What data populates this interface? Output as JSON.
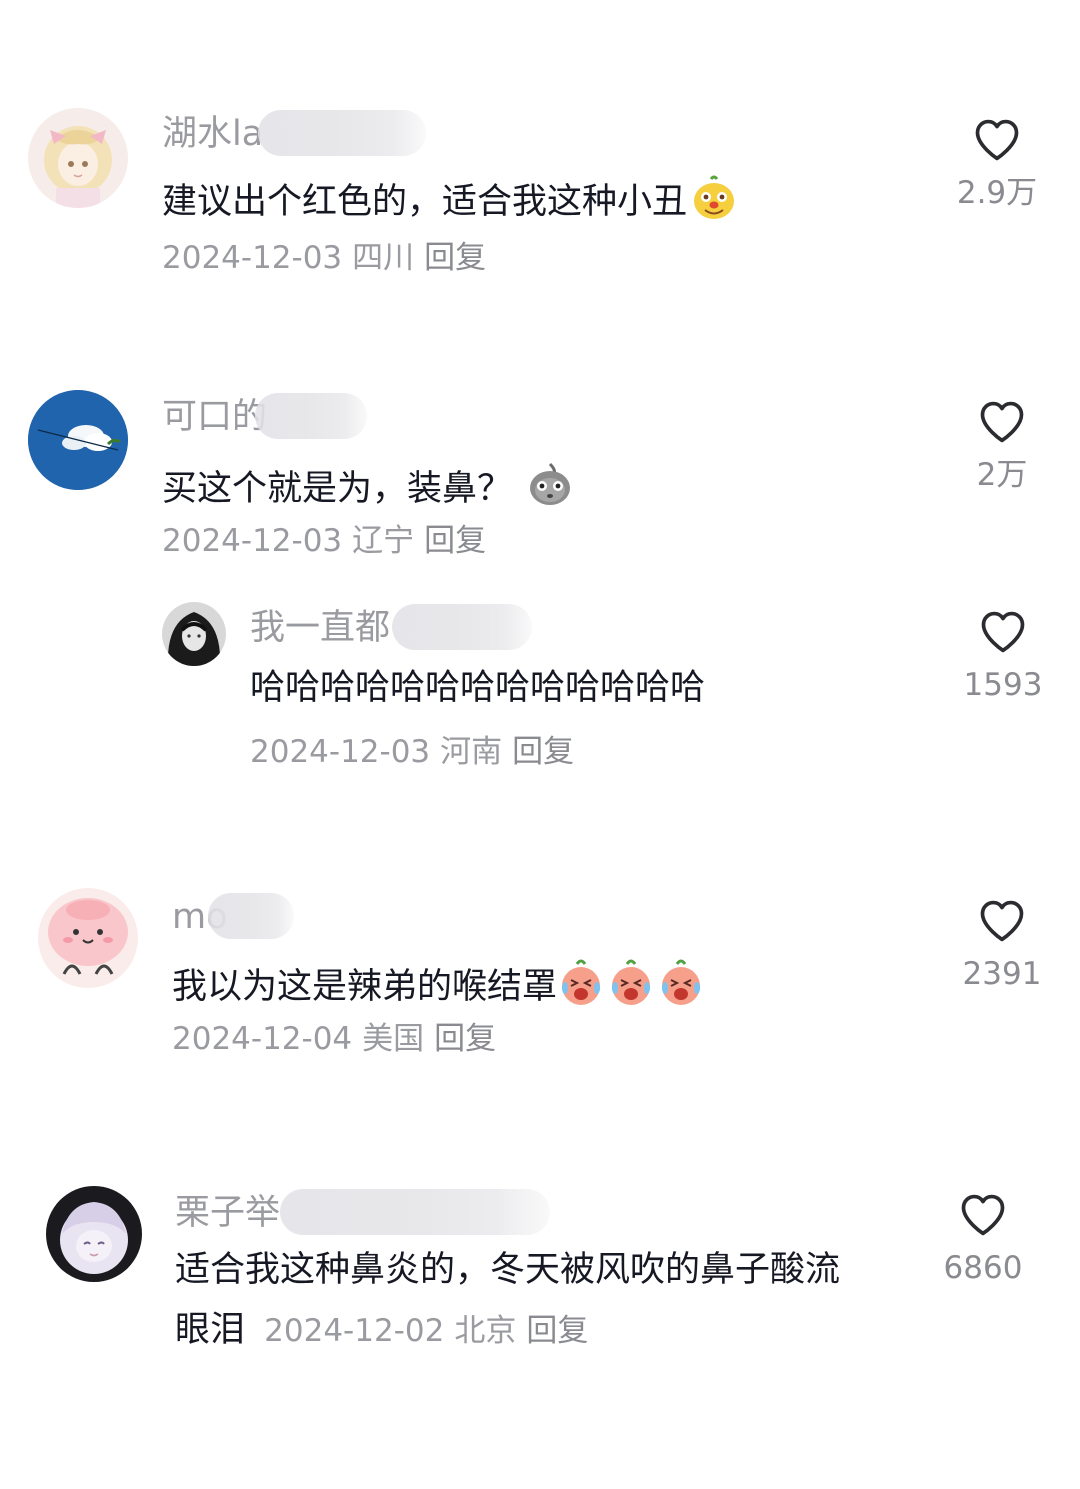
{
  "comments": [
    {
      "name": "湖水la",
      "text": "建议出个红色的，适合我这种小丑",
      "date": "2024-12-03",
      "location": "四川",
      "reply": "回复",
      "likes": "2.9万",
      "avatar_icon": "anime-girl-avatar",
      "emoji_icon": "clown-face-icon"
    },
    {
      "name": "可口的",
      "text": "买这个就是为，装鼻？",
      "date": "2024-12-03",
      "location": "辽宁",
      "reply": "回复",
      "likes": "2万",
      "avatar_icon": "cloud-sky-avatar",
      "emoji_icon": "sweating-face-icon",
      "replies": [
        {
          "name": "我一直都",
          "text": "哈哈哈哈哈哈哈哈哈哈哈哈哈",
          "date": "2024-12-03",
          "location": "河南",
          "reply": "回复",
          "likes": "1593",
          "avatar_icon": "dark-hair-girl-avatar"
        }
      ]
    },
    {
      "name": "mo",
      "text": "我以为这是辣弟的喉结罩",
      "date": "2024-12-04",
      "location": "美国",
      "reply": "回复",
      "likes": "2391",
      "avatar_icon": "pink-blob-avatar",
      "emoji_icon": "crying-laughing-face-icon"
    },
    {
      "name": "栗子举",
      "text_line1": "适合我这种鼻炎的，冬天被风吹的鼻子酸流",
      "text_line2": "眼泪",
      "date": "2024-12-02",
      "location": "北京",
      "reply": "回复",
      "likes": "6860",
      "avatar_icon": "anime-boy-avatar"
    }
  ],
  "colors": {
    "text": "#161823",
    "muted": "#9a9ba0",
    "background": "#ffffff"
  }
}
